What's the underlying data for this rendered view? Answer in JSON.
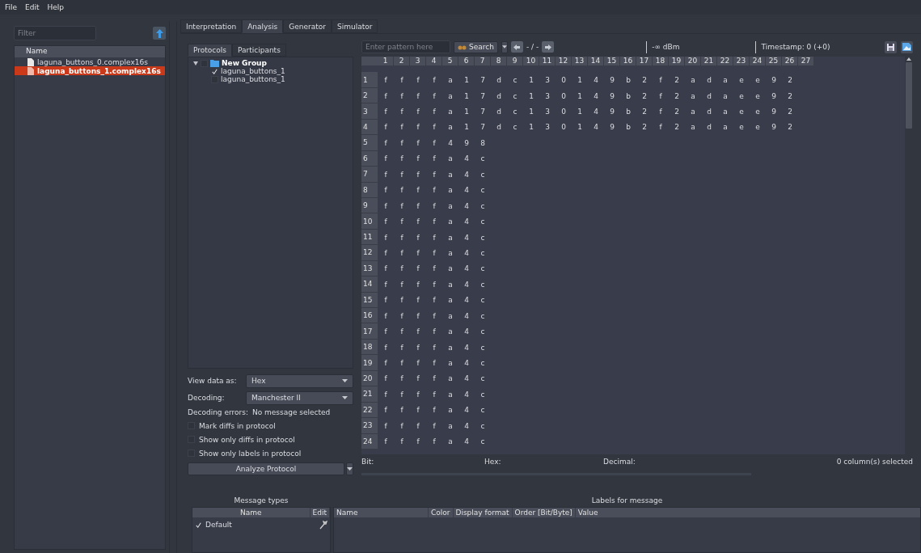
{
  "menu": [
    {
      "label": "File"
    },
    {
      "label": "Edit"
    },
    {
      "label": "Help"
    }
  ],
  "file_panel": {
    "filter_placeholder": "Filter",
    "column": "Name",
    "files": [
      {
        "name": "laguna_buttons_0.complex16s",
        "selected": false
      },
      {
        "name": "laguna_buttons_1.complex16s",
        "selected": true
      }
    ]
  },
  "tabs": [
    {
      "label": "Interpretation",
      "selected": false
    },
    {
      "label": "Analysis",
      "selected": true
    },
    {
      "label": "Generator",
      "selected": false
    },
    {
      "label": "Simulator",
      "selected": false
    }
  ],
  "subtabs": [
    {
      "label": "Protocols",
      "selected": true
    },
    {
      "label": "Participants",
      "selected": false
    }
  ],
  "protocol_tree": {
    "label": "New Group",
    "expanded": true,
    "checked": false,
    "children": [
      {
        "label": "laguna_buttons_1",
        "checked": true
      },
      {
        "label": "laguna_buttons_1",
        "checked": false
      }
    ]
  },
  "options": {
    "view_label": "View data as:",
    "view_value": "Hex",
    "decoding_label": "Decoding:",
    "decoding_value": "Manchester II",
    "errors_label": "Decoding errors:",
    "errors_value": "No message selected",
    "checkboxes": [
      {
        "label": "Mark diffs in protocol",
        "checked": false
      },
      {
        "label": "Show only diffs in protocol",
        "checked": false
      },
      {
        "label": "Show only labels in protocol",
        "checked": false
      }
    ],
    "analyze_button": "Analyze Protocol"
  },
  "search": {
    "placeholder": "Enter pattern here",
    "button": "Search",
    "position": "- / -",
    "rssi": "-∞ dBm",
    "timestamp": "Timestamp:  0 (+0)"
  },
  "table": {
    "columns": [
      "1",
      "2",
      "3",
      "4",
      "5",
      "6",
      "7",
      "8",
      "9",
      "10",
      "11",
      "12",
      "13",
      "14",
      "15",
      "16",
      "17",
      "18",
      "19",
      "20",
      "21",
      "22",
      "23",
      "24",
      "25",
      "26",
      "27"
    ],
    "rows": [
      {
        "label": "1",
        "cells": [
          "f",
          "f",
          "f",
          "f",
          "a",
          "1",
          "7",
          "d",
          "c",
          "1",
          "3",
          "0",
          "1",
          "4",
          "9",
          "b",
          "2",
          "f",
          "2",
          "a",
          "d",
          "a",
          "e",
          "e",
          "9",
          "2"
        ]
      },
      {
        "label": "2",
        "cells": [
          "f",
          "f",
          "f",
          "f",
          "a",
          "1",
          "7",
          "d",
          "c",
          "1",
          "3",
          "0",
          "1",
          "4",
          "9",
          "b",
          "2",
          "f",
          "2",
          "a",
          "d",
          "a",
          "e",
          "e",
          "9",
          "2"
        ]
      },
      {
        "label": "3",
        "cells": [
          "f",
          "f",
          "f",
          "f",
          "a",
          "1",
          "7",
          "d",
          "c",
          "1",
          "3",
          "0",
          "1",
          "4",
          "9",
          "b",
          "2",
          "f",
          "2",
          "a",
          "d",
          "a",
          "e",
          "e",
          "9",
          "2"
        ]
      },
      {
        "label": "4",
        "cells": [
          "f",
          "f",
          "f",
          "f",
          "a",
          "1",
          "7",
          "d",
          "c",
          "1",
          "3",
          "0",
          "1",
          "4",
          "9",
          "b",
          "2",
          "f",
          "2",
          "a",
          "d",
          "a",
          "e",
          "e",
          "9",
          "2"
        ]
      },
      {
        "label": "5",
        "cells": [
          "f",
          "f",
          "f",
          "f",
          "4",
          "9",
          "8"
        ]
      },
      {
        "label": "6",
        "cells": [
          "f",
          "f",
          "f",
          "f",
          "a",
          "4",
          "c"
        ]
      },
      {
        "label": "7",
        "cells": [
          "f",
          "f",
          "f",
          "f",
          "a",
          "4",
          "c"
        ]
      },
      {
        "label": "8",
        "cells": [
          "f",
          "f",
          "f",
          "f",
          "a",
          "4",
          "c"
        ]
      },
      {
        "label": "9",
        "cells": [
          "f",
          "f",
          "f",
          "f",
          "a",
          "4",
          "c"
        ]
      },
      {
        "label": "10",
        "cells": [
          "f",
          "f",
          "f",
          "f",
          "a",
          "4",
          "c"
        ]
      },
      {
        "label": "11",
        "cells": [
          "f",
          "f",
          "f",
          "f",
          "a",
          "4",
          "c"
        ]
      },
      {
        "label": "12",
        "cells": [
          "f",
          "f",
          "f",
          "f",
          "a",
          "4",
          "c"
        ]
      },
      {
        "label": "13",
        "cells": [
          "f",
          "f",
          "f",
          "f",
          "a",
          "4",
          "c"
        ]
      },
      {
        "label": "14",
        "cells": [
          "f",
          "f",
          "f",
          "f",
          "a",
          "4",
          "c"
        ]
      },
      {
        "label": "15",
        "cells": [
          "f",
          "f",
          "f",
          "f",
          "a",
          "4",
          "c"
        ]
      },
      {
        "label": "16",
        "cells": [
          "f",
          "f",
          "f",
          "f",
          "a",
          "4",
          "c"
        ]
      },
      {
        "label": "17",
        "cells": [
          "f",
          "f",
          "f",
          "f",
          "a",
          "4",
          "c"
        ]
      },
      {
        "label": "18",
        "cells": [
          "f",
          "f",
          "f",
          "f",
          "a",
          "4",
          "c"
        ]
      },
      {
        "label": "19",
        "cells": [
          "f",
          "f",
          "f",
          "f",
          "a",
          "4",
          "c"
        ]
      },
      {
        "label": "20",
        "cells": [
          "f",
          "f",
          "f",
          "f",
          "a",
          "4",
          "c"
        ]
      },
      {
        "label": "21",
        "cells": [
          "f",
          "f",
          "f",
          "f",
          "a",
          "4",
          "c"
        ]
      },
      {
        "label": "22",
        "cells": [
          "f",
          "f",
          "f",
          "f",
          "a",
          "4",
          "c"
        ]
      },
      {
        "label": "23",
        "cells": [
          "f",
          "f",
          "f",
          "f",
          "a",
          "4",
          "c"
        ]
      },
      {
        "label": "24",
        "cells": [
          "f",
          "f",
          "f",
          "f",
          "a",
          "4",
          "c"
        ]
      }
    ]
  },
  "status": {
    "bit": "Bit:",
    "hex": "Hex:",
    "decimal": "Decimal:",
    "selection": "0  column(s) selected"
  },
  "message_types": {
    "title": "Message types",
    "columns": [
      "Name",
      "Edit"
    ],
    "rows": [
      {
        "name": "Default",
        "checked": true
      }
    ]
  },
  "labels": {
    "title": "Labels for message",
    "columns": [
      "Name",
      "Color",
      "Display format",
      "Order [Bit/Byte]",
      "Value"
    ]
  }
}
